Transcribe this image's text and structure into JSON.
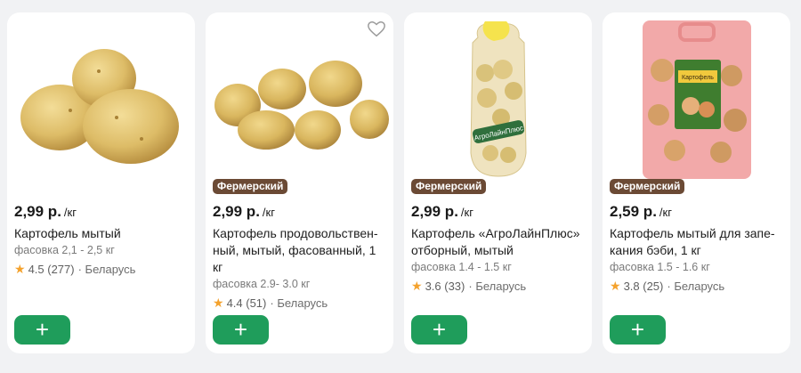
{
  "products": [
    {
      "price": "2,99 р.",
      "unit": "/кг",
      "title": "Картофель мытый",
      "pack": "фасовка 2,1 - 2,5 кг",
      "rating": "4.5 (277)",
      "origin": "· Беларусь",
      "badge": ""
    },
    {
      "badge": "Фермерский",
      "price": "2,99 р.",
      "unit": "/кг",
      "title": "Картофель продовольствен-ный, мытый, фасованный, 1 кг",
      "pack": "фасовка 2.9- 3.0 кг",
      "rating": "4.4 (51)",
      "origin": "· Беларусь"
    },
    {
      "badge": "Фермерский",
      "price": "2,99 р.",
      "unit": "/кг",
      "title": "Картофель «АгроЛайнПлюс» отборный, мытый",
      "pack": "фасовка 1.4 - 1.5 кг",
      "rating": "3.6 (33)",
      "origin": "· Беларусь",
      "bag_label": "АгроЛайнПлюс"
    },
    {
      "badge": "Фермерский",
      "price": "2,59 р.",
      "unit": "/кг",
      "title": "Картофель мытый для запе-кания бэби, 1 кг",
      "pack": "фасовка 1.5 - 1.6 кг",
      "rating": "3.8 (25)",
      "origin": "· Беларусь",
      "bag_label": "Картофель"
    }
  ],
  "icons": {
    "add": "plus-icon",
    "favorite": "heart-icon",
    "rating": "star-icon"
  },
  "colors": {
    "add_button": "#1f9d5b",
    "badge": "#6b4a35",
    "star": "#f4a22d"
  }
}
